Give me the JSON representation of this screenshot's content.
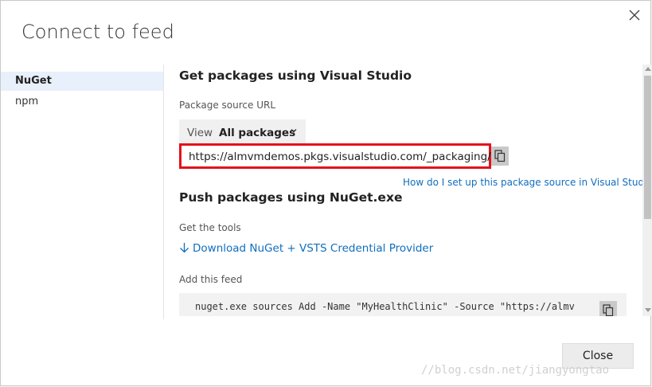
{
  "dialog": {
    "title": "Connect to feed",
    "close_icon": "close-icon"
  },
  "sidebar": {
    "items": [
      {
        "label": "NuGet",
        "active": true
      },
      {
        "label": "npm",
        "active": false
      }
    ]
  },
  "visual_studio": {
    "heading": "Get packages using Visual Studio",
    "source_label": "Package source URL",
    "view_label": "View",
    "view_value": "All packages",
    "url": "https://almvmdemos.pkgs.visualstudio.com/_packaging/...",
    "help_link": "How do I set up this package source in Visual Studio?"
  },
  "nuget_exe": {
    "heading": "Push packages using NuGet.exe",
    "tools_label": "Get the tools",
    "download_link": "Download NuGet + VSTS Credential Provider",
    "add_feed_label": "Add this feed",
    "command": "nuget.exe sources Add -Name \"MyHealthClinic\" -Source \"https://almv"
  },
  "footer": {
    "close_label": "Close"
  },
  "watermark": "//blog.csdn.net/jiangyongtao",
  "colors": {
    "accent": "#106ebe",
    "highlight_border": "#e2131b",
    "active_item_bg": "#e8f0fb"
  }
}
